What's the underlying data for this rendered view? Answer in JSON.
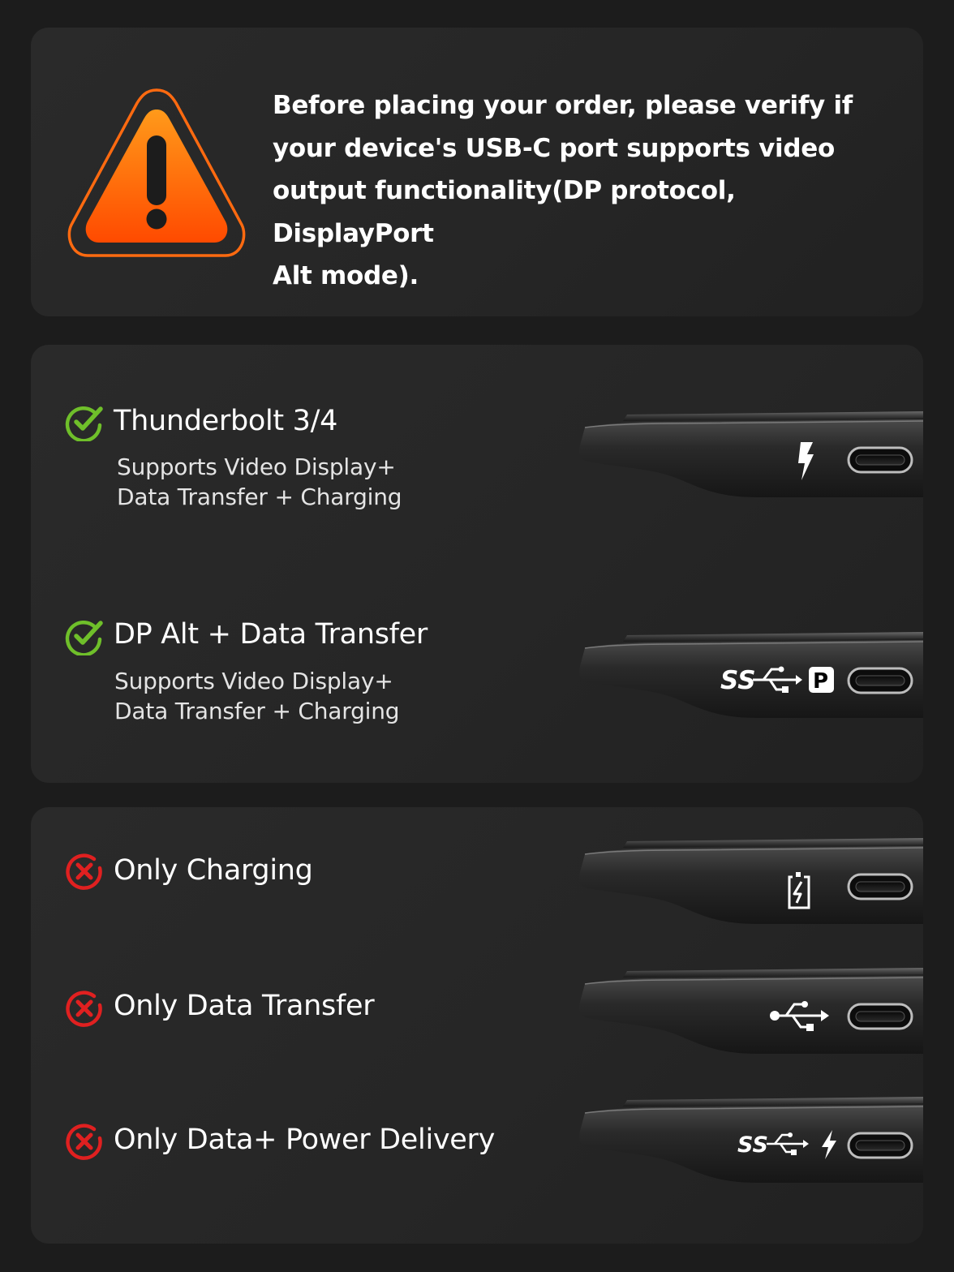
{
  "notice": {
    "lines": [
      "Before placing your order, please verify if",
      "your device's USB-C port supports video",
      "output functionality(DP protocol, DisplayPort",
      "Alt mode)."
    ]
  },
  "supported": [
    {
      "title": "Thunderbolt 3/4",
      "desc_lines": [
        "Supports Video Display+",
        "Data Transfer + Charging"
      ],
      "status": "supported",
      "port_symbol": "thunderbolt-icon"
    },
    {
      "title": "DP Alt + Data Transfer",
      "desc_lines": [
        "Supports Video Display+",
        "Data Transfer + Charging"
      ],
      "status": "supported",
      "port_symbol": "ss-usb-displayport-icon",
      "port_label": "SS"
    }
  ],
  "unsupported": [
    {
      "title": "Only Charging",
      "status": "unsupported",
      "port_symbol": "battery-charge-icon"
    },
    {
      "title": "Only Data Transfer",
      "status": "unsupported",
      "port_symbol": "usb-icon"
    },
    {
      "title": "Only Data+ Power Delivery",
      "status": "unsupported",
      "port_symbol": "ss-usb-lightning-icon",
      "port_label": "SS"
    }
  ],
  "colors": {
    "background": "#1c1c1c",
    "card": "#282828",
    "warning_orange": "#ff5a0a",
    "check_green": "#6fbf2a",
    "cross_red": "#e02020"
  }
}
